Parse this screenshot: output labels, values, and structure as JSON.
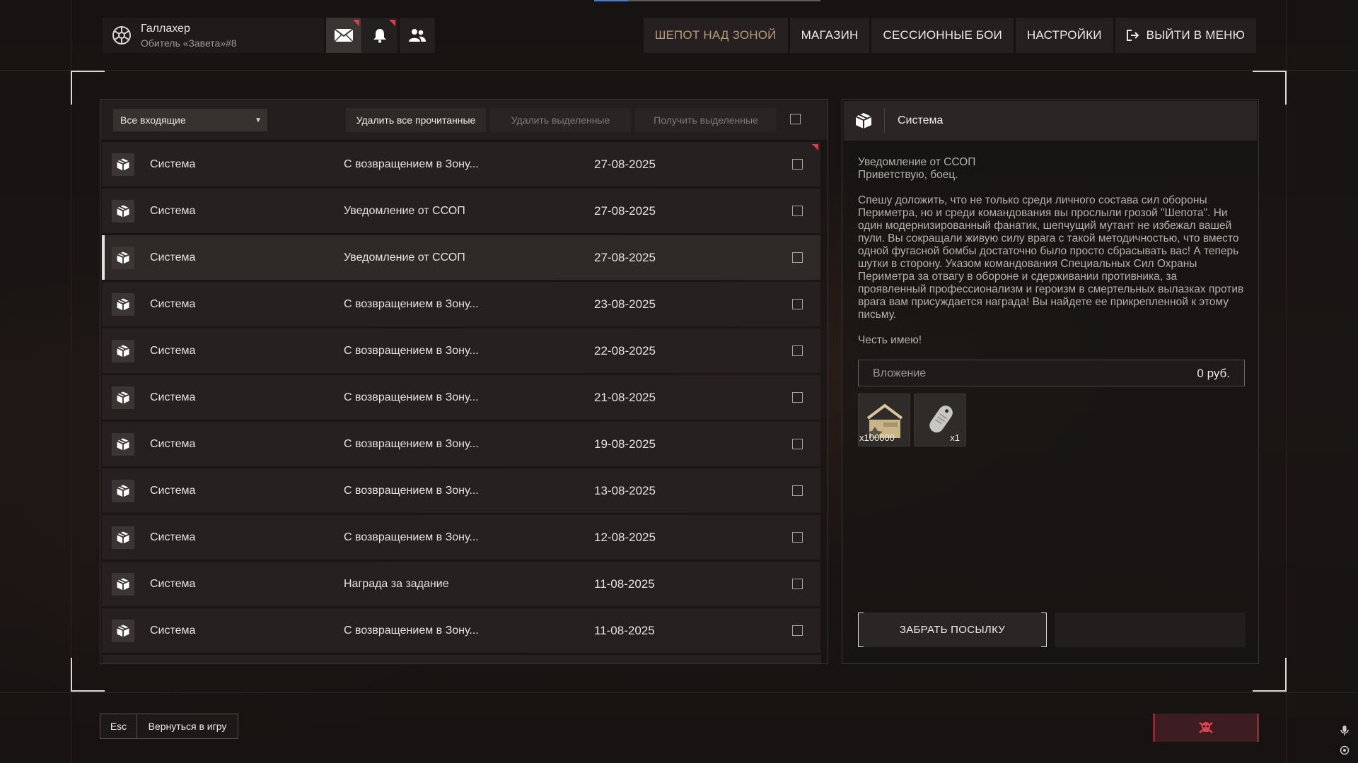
{
  "top_progress": {
    "fraction": 0.15
  },
  "profile": {
    "name": "Галлахер",
    "clan": "Обитель «Завета»#8"
  },
  "header_icons": [
    "mail-icon",
    "bell-icon",
    "friends-icon"
  ],
  "nav": {
    "whisper": "ШЕПОТ НАД ЗОНОЙ",
    "shop": "МАГАЗИН",
    "sessions": "СЕССИОННЫЕ БОИ",
    "settings": "НАСТРОЙКИ",
    "exit": "ВЫЙТИ В МЕНЮ"
  },
  "toolbar": {
    "filter_value": "Все входящие",
    "delete_read": "Удалить все прочитанные",
    "delete_selected": "Удалить выделенные",
    "receive_selected": "Получить выделенные"
  },
  "mail": [
    {
      "sender": "Система",
      "subject": "С возвращением в Зону...",
      "date": "27-08-2025",
      "unread": true,
      "selected": false
    },
    {
      "sender": "Система",
      "subject": "Уведомление от ССОП",
      "date": "27-08-2025",
      "unread": false,
      "selected": false
    },
    {
      "sender": "Система",
      "subject": "Уведомление от ССОП",
      "date": "27-08-2025",
      "unread": false,
      "selected": true
    },
    {
      "sender": "Система",
      "subject": "С возвращением в Зону...",
      "date": "23-08-2025",
      "unread": false,
      "selected": false
    },
    {
      "sender": "Система",
      "subject": "С возвращением в Зону...",
      "date": "22-08-2025",
      "unread": false,
      "selected": false
    },
    {
      "sender": "Система",
      "subject": "С возвращением в Зону...",
      "date": "21-08-2025",
      "unread": false,
      "selected": false
    },
    {
      "sender": "Система",
      "subject": "С возвращением в Зону...",
      "date": "19-08-2025",
      "unread": false,
      "selected": false
    },
    {
      "sender": "Система",
      "subject": "С возвращением в Зону...",
      "date": "13-08-2025",
      "unread": false,
      "selected": false
    },
    {
      "sender": "Система",
      "subject": "С возвращением в Зону...",
      "date": "12-08-2025",
      "unread": false,
      "selected": false
    },
    {
      "sender": "Система",
      "subject": "Награда за задание",
      "date": "11-08-2025",
      "unread": false,
      "selected": false
    },
    {
      "sender": "Система",
      "subject": "С возвращением в Зону...",
      "date": "11-08-2025",
      "unread": false,
      "selected": false
    }
  ],
  "message": {
    "from": "Система",
    "title_line": "Уведомление от ССОП",
    "greeting": "Приветствую, боец.",
    "body": "Спешу доложить, что не только среди личного состава сил обороны Периметра, но и среди командования вы прослыли грозой \"Шепота\". Ни один модернизированный фанатик, шепчущий мутант не избежал вашей пули. Вы сокращали живую силу врага с такой методичностью, что вместо одной фугасной бомбы достаточно было просто сбрасывать вас! А теперь шутки в сторону. Указом командования Специальных Сил Охраны Периметра за отвагу в обороне и сдерживании противника, за проявленный профессионализм и героизм в смертельных вылазках против врага вам присуждается награда! Вы найдете ее прикрепленной к этому письму.",
    "sign": "Честь имею!",
    "attachment_label": "Вложение",
    "attachment_amount": "0 руб.",
    "items": [
      {
        "icon": "reputation-badge-icon",
        "qty": "x100000"
      },
      {
        "icon": "dog-tag-icon",
        "qty": "x1"
      }
    ],
    "claim_button": "ЗАБРАТЬ ПОСЫЛКУ"
  },
  "bottom": {
    "esc_key": "Esc",
    "back": "Вернуться в игру"
  },
  "colors": {
    "accent_red": "#d1424a",
    "active_nav": "#b89a78",
    "background": "#141110"
  }
}
